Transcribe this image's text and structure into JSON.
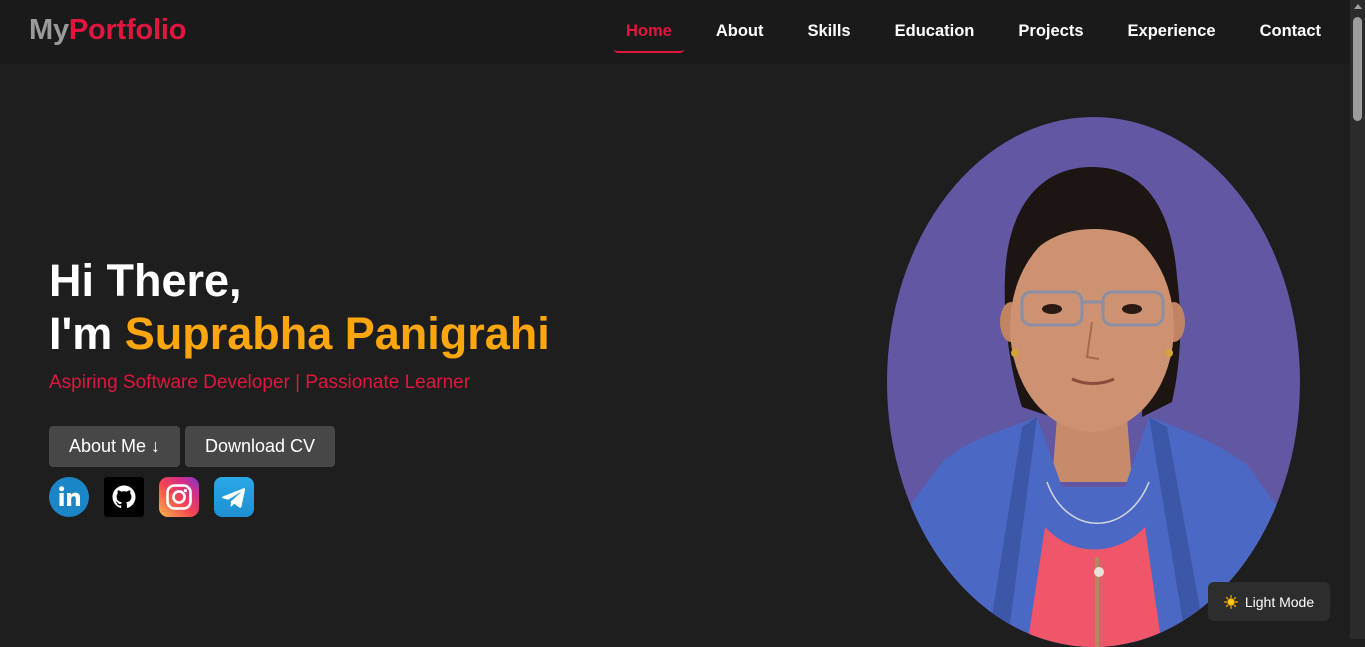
{
  "logo": {
    "my": "My",
    "portfolio": "Portfolio"
  },
  "nav": {
    "items": [
      {
        "label": "Home",
        "active": true
      },
      {
        "label": "About",
        "active": false
      },
      {
        "label": "Skills",
        "active": false
      },
      {
        "label": "Education",
        "active": false
      },
      {
        "label": "Projects",
        "active": false
      },
      {
        "label": "Experience",
        "active": false
      },
      {
        "label": "Contact",
        "active": false
      }
    ]
  },
  "hero": {
    "greeting": "Hi There,",
    "im": "I'm ",
    "name": "Suprabha Panigrahi",
    "subtitle": "Aspiring Software Developer | Passionate Learner",
    "about_button": "About Me ↓",
    "cv_button": "Download CV"
  },
  "social": [
    "linkedin-icon",
    "github-icon",
    "instagram-icon",
    "telegram-icon"
  ],
  "theme_toggle": {
    "label": "Light Mode",
    "icon": "sun-icon"
  },
  "colors": {
    "accent": "#e0163f",
    "name_highlight": "#fba60c",
    "background": "#1e1e1e",
    "navbar": "#1a1a1a",
    "button": "#474747",
    "logo_gray": "#9a9a9a",
    "photo_background": "#6157a3"
  }
}
